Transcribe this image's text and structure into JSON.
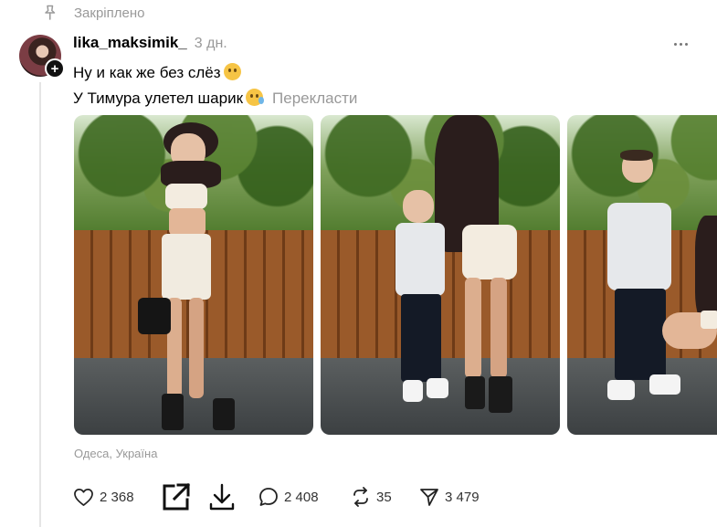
{
  "pinned": {
    "label": "Закріплено",
    "icon": "pin-icon"
  },
  "post": {
    "username": "lika_maksimik_",
    "time": "3 дн.",
    "caption_line1": "Ну и как же без слёз",
    "caption_line2": "У Тимура улетел шарик",
    "translate_label": "Перекласти",
    "location": "Одеса, Україна"
  },
  "actions": {
    "likes": "2 368",
    "comments": "2 408",
    "reposts": "35",
    "shares": "3 479"
  },
  "colors": {
    "muted": "#999999",
    "text": "#000000",
    "divider": "#e5e5e5"
  }
}
